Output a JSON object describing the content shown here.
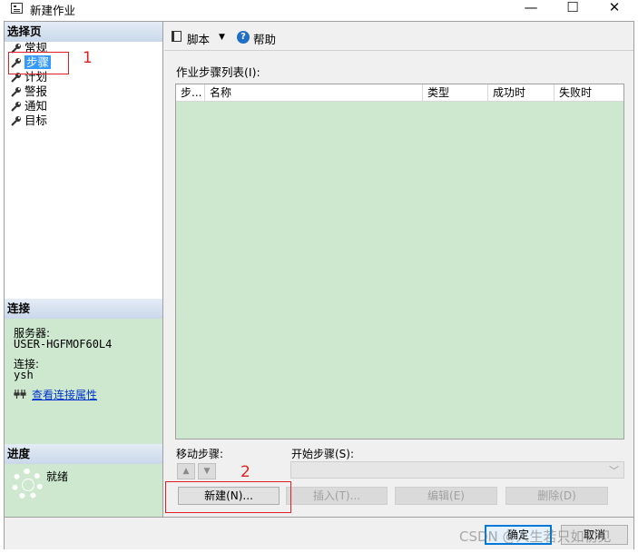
{
  "window": {
    "title": "新建作业",
    "minimize": "—",
    "maximize": "☐",
    "close": "✕"
  },
  "sidebar": {
    "header": "选择页",
    "items": [
      {
        "label": "常规"
      },
      {
        "label": "步骤",
        "selected": true
      },
      {
        "label": "计划"
      },
      {
        "label": "警报"
      },
      {
        "label": "通知"
      },
      {
        "label": "目标"
      }
    ]
  },
  "connection": {
    "header": "连接",
    "server_label": "服务器:",
    "server_value": "USER-HGFMOF60L4",
    "conn_label": "连接:",
    "conn_value": "ysh",
    "view_link": "查看连接属性"
  },
  "progress": {
    "header": "进度",
    "status": "就绪"
  },
  "toolbar": {
    "script_label": "脚本",
    "help_label": "帮助"
  },
  "steps": {
    "list_label": "作业步骤列表(I):",
    "columns": [
      "步...",
      "名称",
      "类型",
      "成功时",
      "失败时"
    ],
    "move_label": "移动步骤:",
    "start_label": "开始步骤(S):",
    "start_value": ""
  },
  "buttons": {
    "new": "新建(N)...",
    "insert": "插入(T)...",
    "edit": "编辑(E)",
    "delete": "删除(D)",
    "ok": "确定",
    "cancel": "取消"
  },
  "annotations": {
    "num1": "1",
    "num2": "2",
    "color": "#e02020"
  },
  "watermark": "CSDN @人生若只如初见",
  "colors": {
    "selection": "#3399ff",
    "panel_green": "#cde8cf",
    "link": "#0033cc",
    "default_button_border": "#0078d7"
  }
}
